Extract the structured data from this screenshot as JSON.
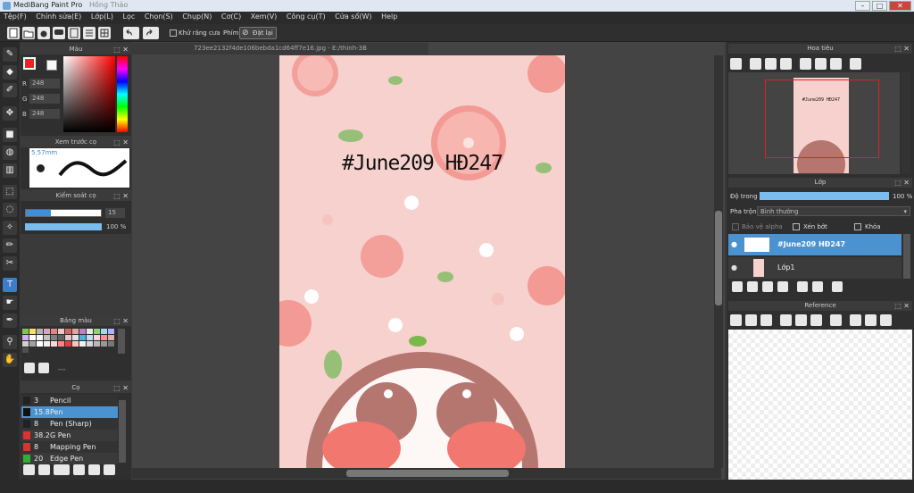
{
  "window": {
    "app_title": "MediBang Paint Pro",
    "ghost_title": "Hồng Thảo"
  },
  "menu": [
    "Tệp(F)",
    "Chỉnh sửa(E)",
    "Lớp(L)",
    "Lọc",
    "Chọn(S)",
    "Chụp(N)",
    "Cơ(C)",
    "Xem(V)",
    "Công cụ(T)",
    "Cửa sổ(W)",
    "Help"
  ],
  "toolbar": {
    "antialias_label": "Khử răng cưa",
    "phim_label": "Phím",
    "reset_label": "Đặt lại"
  },
  "color_panel": {
    "title": "Màu",
    "r_label": "R",
    "g_label": "G",
    "b_label": "B",
    "r": "248",
    "g": "248",
    "b": "248"
  },
  "brush_preview": {
    "title": "Xem trước cọ",
    "size": "5.57mm"
  },
  "brush_control": {
    "title": "Kiểm soát cọ",
    "size": "15",
    "opacity": "100 %"
  },
  "palette": {
    "title": "Bảng màu",
    "footer": "---"
  },
  "brush_panel": {
    "title": "Cọ",
    "items": [
      {
        "num": "3",
        "name": "Pencil",
        "color": "#222222"
      },
      {
        "num": "15.8",
        "name": "Pen",
        "color": "#111111"
      },
      {
        "num": "8",
        "name": "Pen (Sharp)",
        "color": "#222222"
      },
      {
        "num": "38.2",
        "name": "G Pen",
        "color": "#e03030"
      },
      {
        "num": "8",
        "name": "Mapping Pen",
        "color": "#e03030"
      },
      {
        "num": "20",
        "name": "Edge Pen",
        "color": "#30b030"
      }
    ]
  },
  "document": {
    "tab": "723ee2132f4de106bebda1cd64ff7e16.jpg - E:/thinh-3B",
    "art_text": "#June209 HĐ247"
  },
  "navigator": {
    "title": "Hoa tiêu",
    "thumb_text": "#June209 HĐ247"
  },
  "layer_panel": {
    "title": "Lớp",
    "opacity_label": "Độ trong",
    "opacity_value": "100 %",
    "blend_label": "Pha trộn",
    "blend_value": "Bình thường",
    "protect_alpha": "Bảo vệ alpha",
    "clipping": "Xén bớt",
    "lock": "Khóa",
    "layers": [
      {
        "name": "#June209 HĐ247",
        "selected": true
      },
      {
        "name": "Lớp1",
        "selected": false
      }
    ]
  },
  "reference": {
    "title": "Reference"
  },
  "colors": {
    "accent": "#3d7cc9",
    "selected_layer": "#4a93d0",
    "artwork_bg": "#f6d1cd"
  }
}
